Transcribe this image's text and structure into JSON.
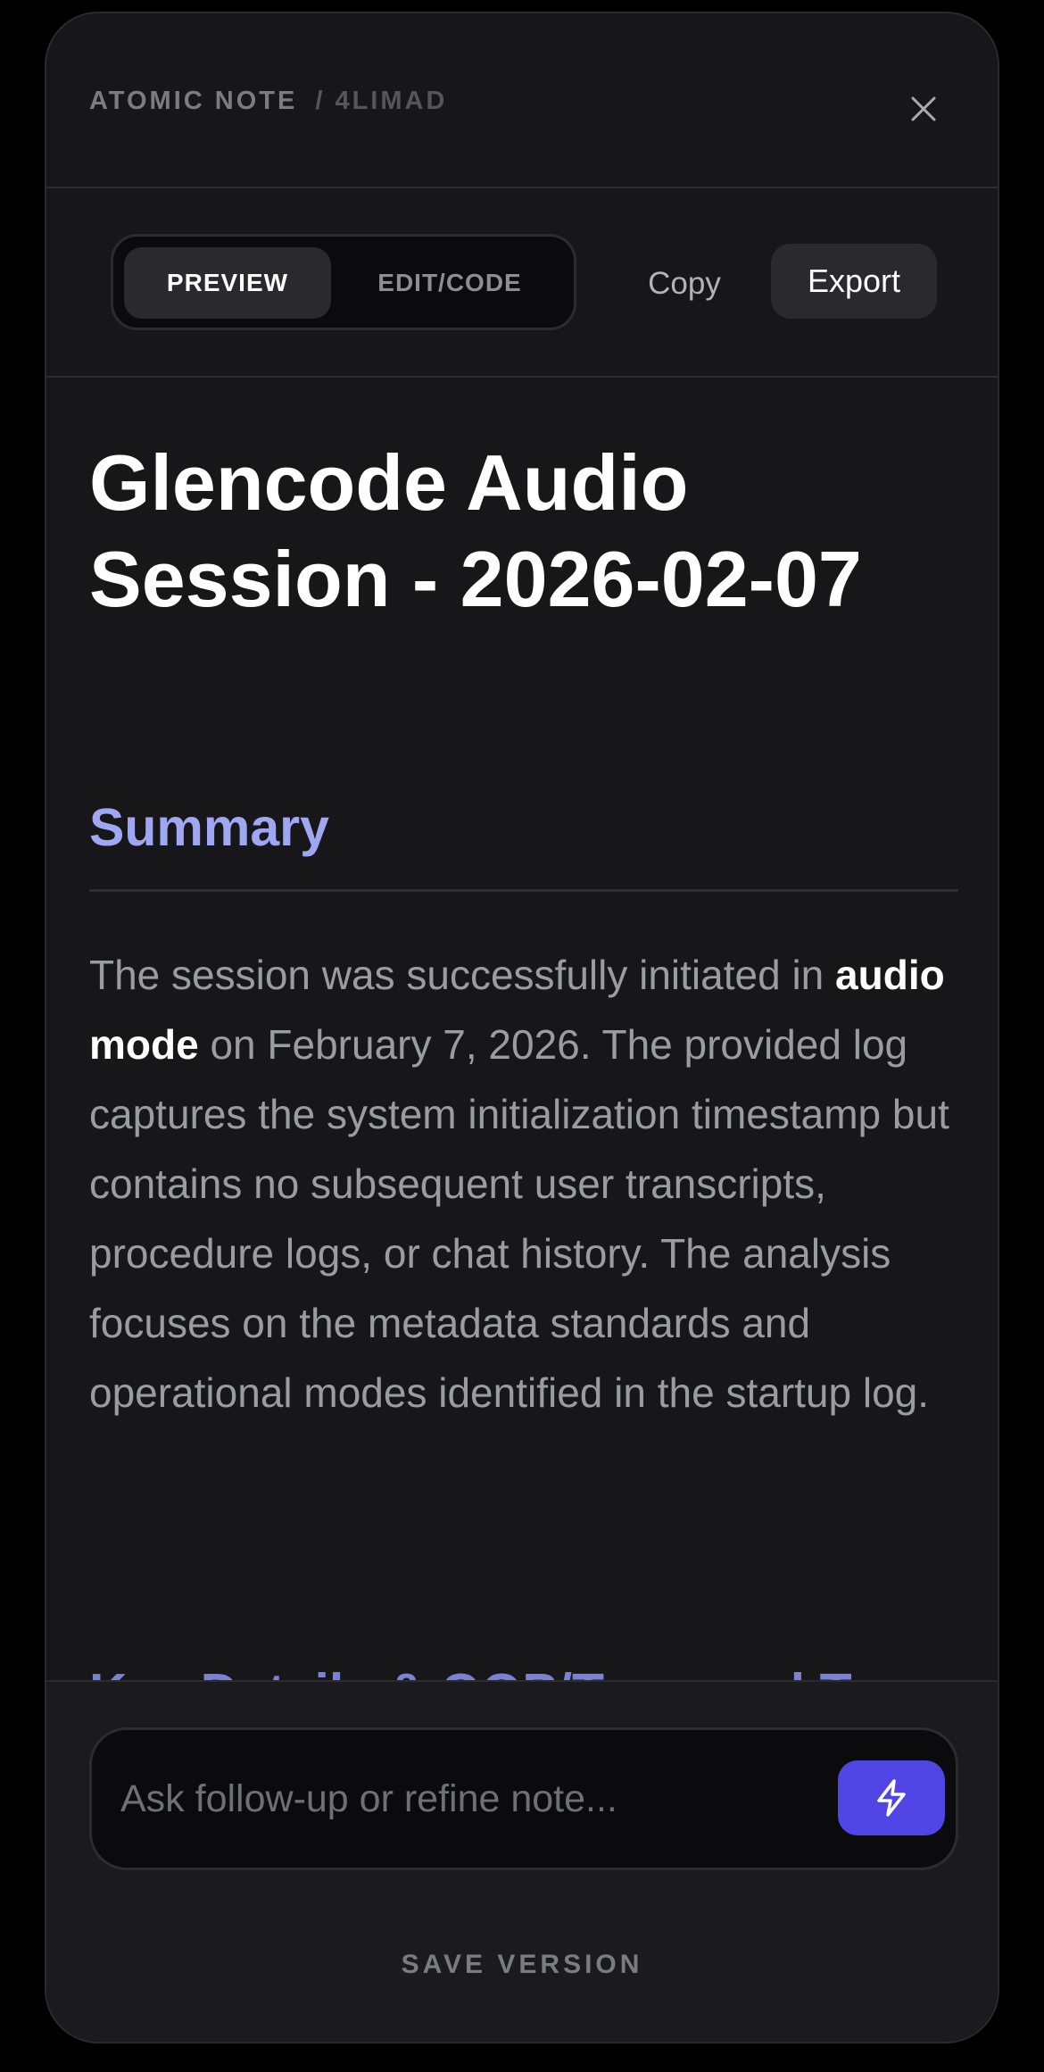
{
  "header": {
    "label": "ATOMIC NOTE",
    "separator": "/",
    "note_id": "4LIMAD",
    "close_icon": "close-icon"
  },
  "toolbar": {
    "tabs": [
      {
        "label": "PREVIEW",
        "active": true
      },
      {
        "label": "EDIT/CODE",
        "active": false
      }
    ],
    "copy_label": "Copy",
    "export_label": "Export"
  },
  "document": {
    "title": "Glencode Audio Session - 2026-02-07",
    "summary_heading": "Summary",
    "summary": {
      "before": "The session was successfully initiated in ",
      "bold": "audio mode",
      "after": " on February 7, 2026. The provided log captures the system initialization timestamp but contains no subsequent user transcripts, procedure logs, or chat history. The analysis focuses on the metadata standards and operational modes identified in the startup log."
    },
    "next_heading": "Key Details & OOP/Temporal T..."
  },
  "footer": {
    "input_placeholder": "Ask follow-up or refine note...",
    "input_value": "",
    "send_icon": "lightning-icon",
    "save_label": "SAVE VERSION"
  },
  "colors": {
    "background": "#17171a",
    "accent": "#4f46e5",
    "heading_accent": "#9fa6f2"
  }
}
